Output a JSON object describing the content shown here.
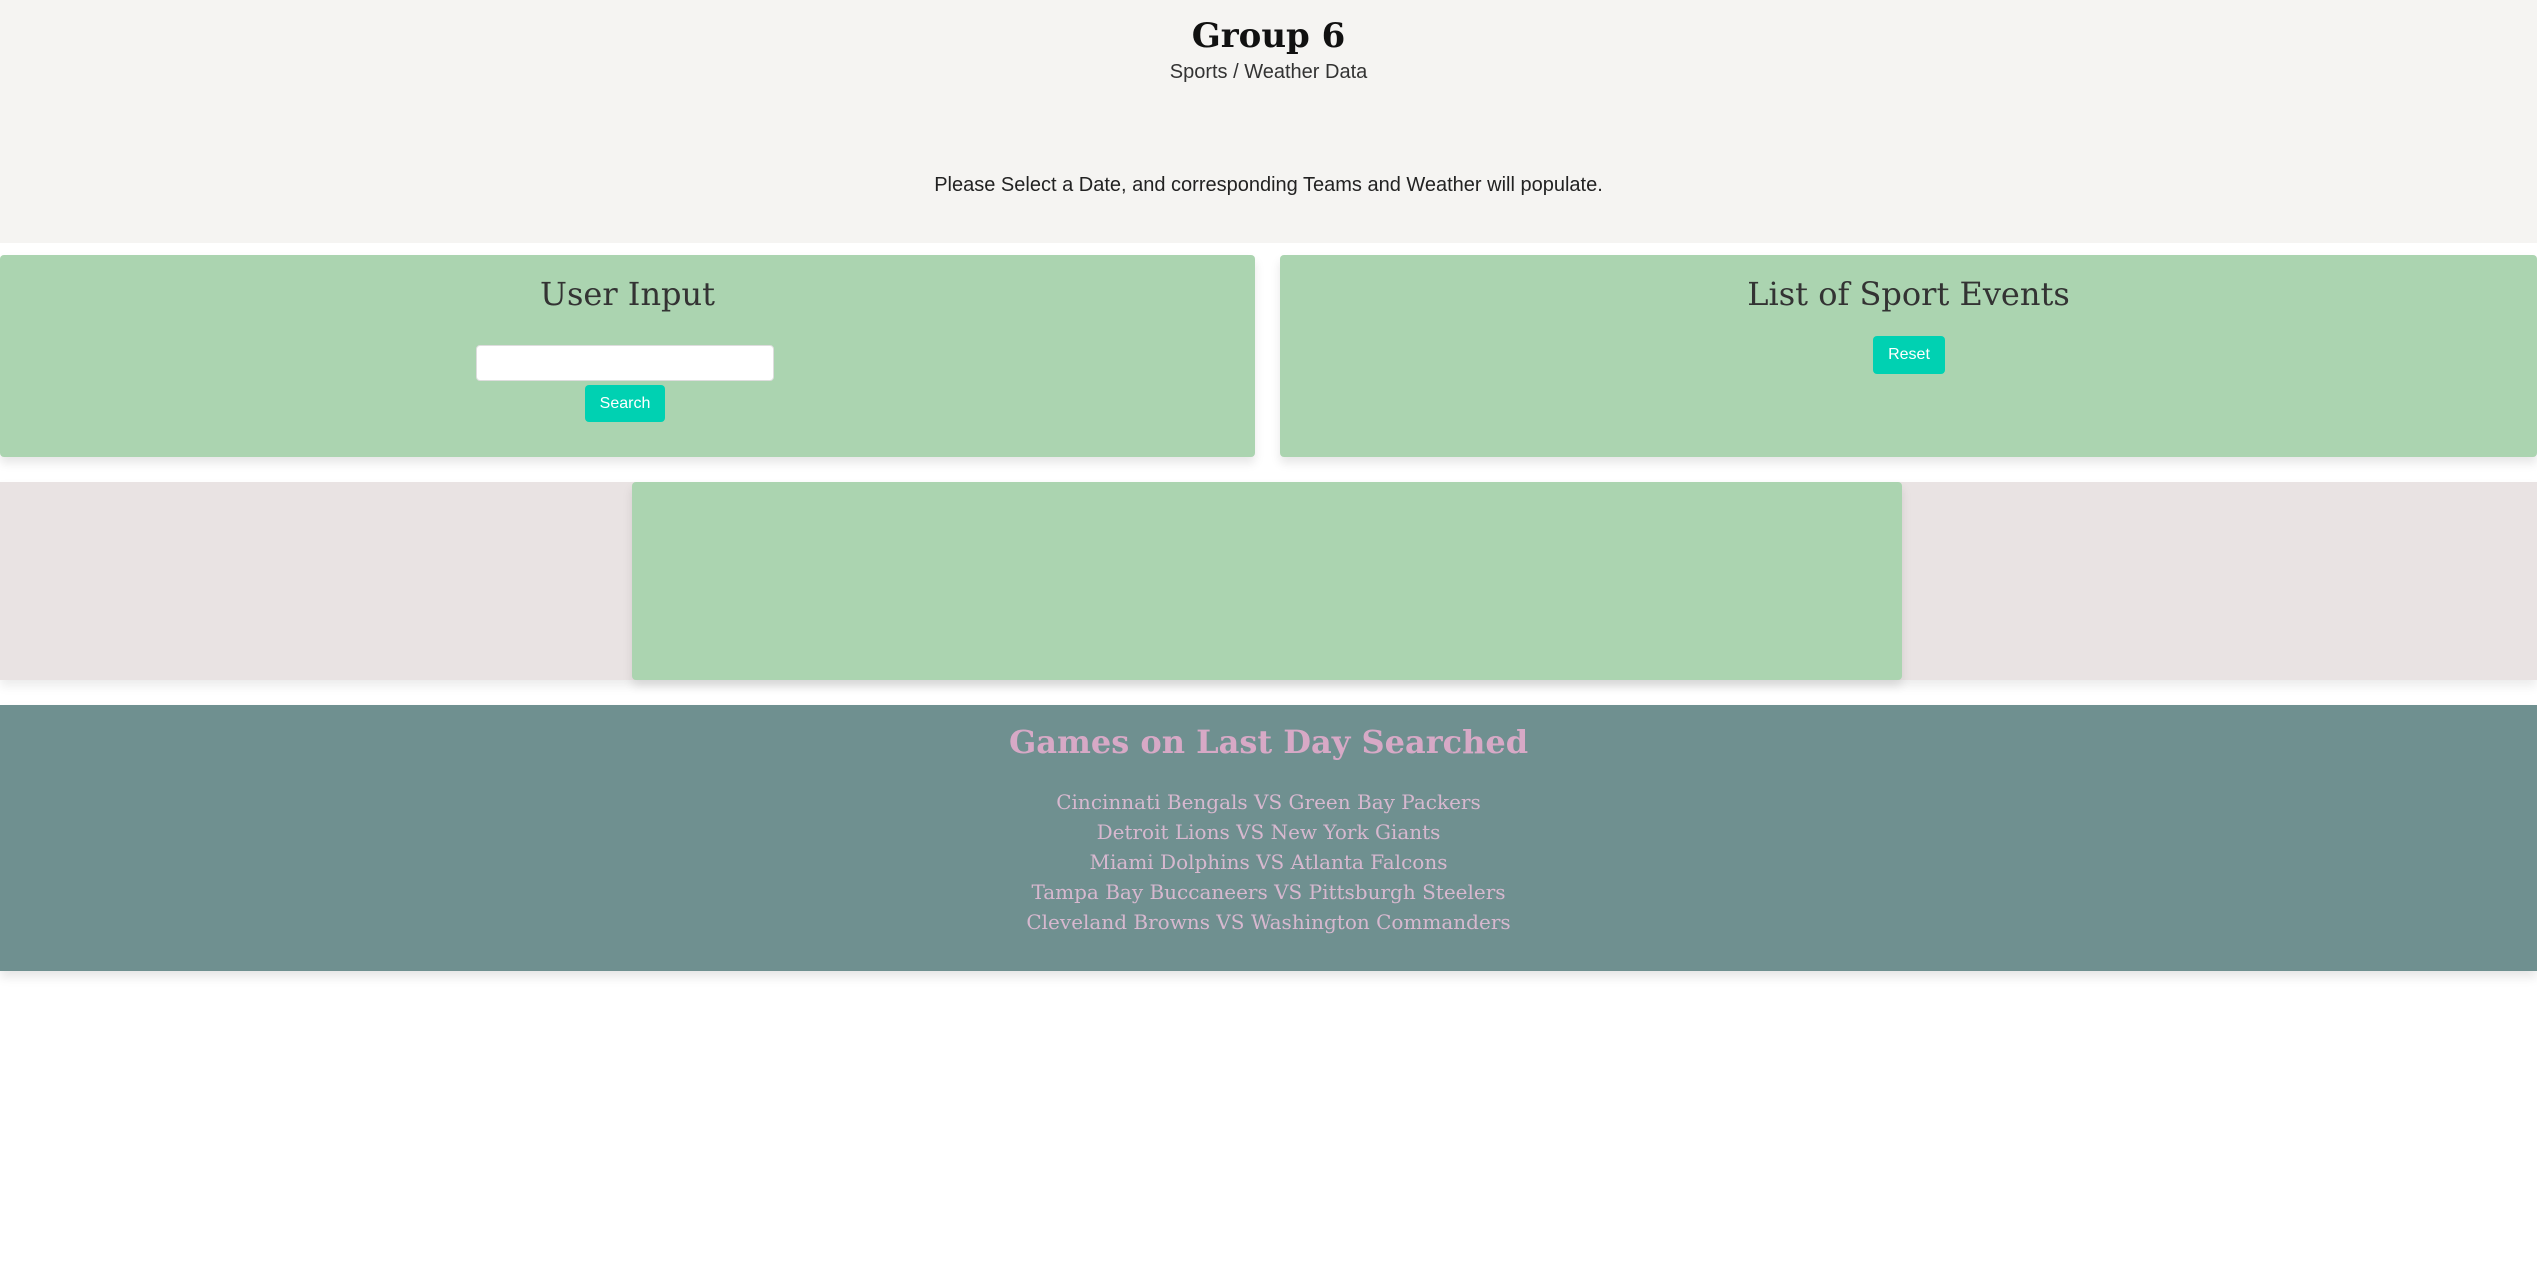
{
  "header": {
    "title": "Group 6",
    "subtitle": "Sports / Weather Data",
    "instructions": "Please Select a Date, and corresponding Teams and Weather will populate."
  },
  "user_input": {
    "heading": "User Input",
    "date_value": "",
    "search_label": "Search"
  },
  "sport_events": {
    "heading": "List of Sport Events",
    "reset_label": "Reset"
  },
  "history": {
    "heading": "Games on Last Day Searched",
    "games": [
      "Cincinnati Bengals VS Green Bay Packers",
      "Detroit Lions VS New York Giants",
      "Miami Dolphins VS Atlanta Falcons",
      "Tampa Bay Buccaneers VS Pittsburgh Steelers",
      "Cleveland Browns VS Washington Commanders"
    ]
  },
  "colors": {
    "card_green": "#abd4b0",
    "button_teal": "#00d1b2",
    "history_band": "#6f9090",
    "history_text": "#d7a9c6"
  }
}
